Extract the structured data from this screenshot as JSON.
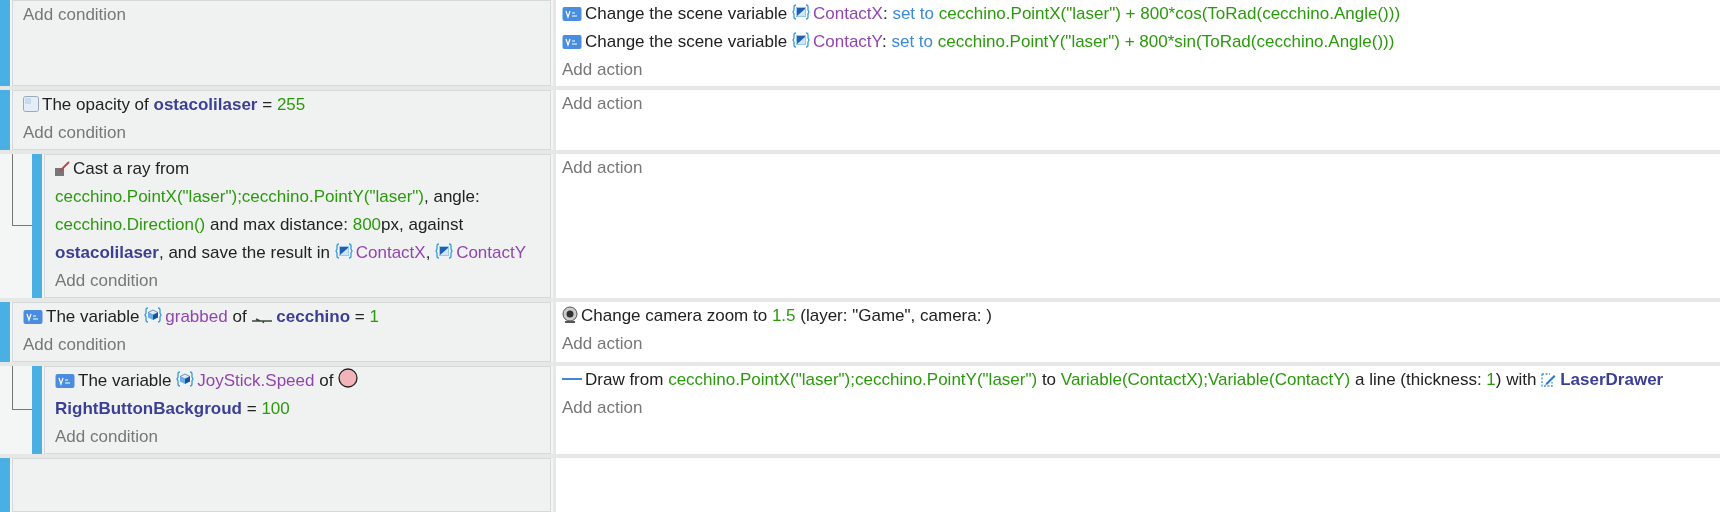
{
  "events": [
    {
      "add_condition": "Add condition",
      "actions": [
        {
          "kind": "variable",
          "parts": [
            {
              "kind": "text",
              "text": "Change the scene variable"
            },
            {
              "kind": "scene_variable",
              "text": "ContactX",
              "nospace": true
            },
            {
              "kind": "text",
              "text": ":"
            },
            {
              "kind": "keyword",
              "text": "set to"
            },
            {
              "kind": "value",
              "text": "cecchino.PointX(\"laser\") + 800*cos(ToRad(cecchino.Angle()))"
            }
          ]
        },
        {
          "kind": "variable",
          "parts": [
            {
              "kind": "text",
              "text": "Change the scene variable"
            },
            {
              "kind": "scene_variable",
              "text": "ContactY",
              "nospace": true
            },
            {
              "kind": "text",
              "text": ":"
            },
            {
              "kind": "keyword",
              "text": "set to"
            },
            {
              "kind": "value",
              "text": "cecchino.PointY(\"laser\") + 800*sin(ToRad(cecchino.Angle()))"
            }
          ]
        }
      ],
      "add_action": "Add action"
    },
    {
      "conditions": [
        {
          "kind": "opacity",
          "parts": [
            {
              "kind": "text",
              "text": "The opacity of"
            },
            {
              "kind": "object",
              "text": "ostacolilaser"
            },
            {
              "kind": "text",
              "text": "="
            },
            {
              "kind": "value",
              "text": "255"
            }
          ]
        }
      ],
      "add_condition": "Add condition",
      "add_action": "Add action",
      "children": [
        {
          "conditions": [
            {
              "kind": "raycast",
              "parts": [
                {
                  "kind": "text",
                  "text": "Cast a ray from"
                },
                {
                  "kind": "value",
                  "text": "cecchino.PointX(\"laser\");cecchino.PointY(\"laser\")",
                  "nospace": true
                },
                {
                  "kind": "text",
                  "text": ", angle:"
                },
                {
                  "kind": "value",
                  "text": "cecchino.Direction()"
                },
                {
                  "kind": "text",
                  "text": "and max distance:"
                },
                {
                  "kind": "value",
                  "text": "800",
                  "nospace": true
                },
                {
                  "kind": "text",
                  "text": "px, against"
                },
                {
                  "kind": "object",
                  "text": "ostacolilaser",
                  "nospace": true
                },
                {
                  "kind": "text",
                  "text": ", and save the result in"
                },
                {
                  "kind": "scene_variable",
                  "text": "ContactX",
                  "nospace": true
                },
                {
                  "kind": "text",
                  "text": ","
                },
                {
                  "kind": "scene_variable",
                  "text": "ContactY"
                }
              ]
            }
          ],
          "add_condition": "Add condition",
          "add_action": "Add action"
        }
      ]
    },
    {
      "conditions": [
        {
          "kind": "variable",
          "parts": [
            {
              "kind": "text",
              "text": "The variable"
            },
            {
              "kind": "object_variable",
              "text": "grabbed"
            },
            {
              "kind": "text",
              "text": "of"
            },
            {
              "kind": "sprite_object",
              "text": "cecchino"
            },
            {
              "kind": "text",
              "text": "="
            },
            {
              "kind": "value",
              "text": "1"
            }
          ]
        }
      ],
      "add_condition": "Add condition",
      "actions": [
        {
          "kind": "camera",
          "parts": [
            {
              "kind": "text",
              "text": "Change camera zoom to"
            },
            {
              "kind": "value",
              "text": "1.5"
            },
            {
              "kind": "text",
              "text": "(layer: \"Game\", camera: )"
            }
          ]
        }
      ],
      "add_action": "Add action",
      "children": [
        {
          "conditions": [
            {
              "kind": "variable",
              "parts": [
                {
                  "kind": "text",
                  "text": "The variable"
                },
                {
                  "kind": "object_variable",
                  "text": "JoyStick.Speed"
                },
                {
                  "kind": "text",
                  "text": "of"
                },
                {
                  "kind": "shape_object",
                  "text": "RightButtonBackgroud"
                },
                {
                  "kind": "text",
                  "text": "="
                },
                {
                  "kind": "value",
                  "text": "100"
                }
              ]
            }
          ],
          "add_condition": "Add condition",
          "actions": [
            {
              "kind": "line",
              "parts": [
                {
                  "kind": "text",
                  "text": "Draw from"
                },
                {
                  "kind": "value",
                  "text": "cecchino.PointX(\"laser\");cecchino.PointY(\"laser\")"
                },
                {
                  "kind": "text",
                  "text": "to"
                },
                {
                  "kind": "value",
                  "text": "Variable(ContactX);Variable(ContactY)"
                },
                {
                  "kind": "text",
                  "text": "a line (thickness:"
                },
                {
                  "kind": "value",
                  "text": "1",
                  "nospace": true
                },
                {
                  "kind": "text",
                  "text": ")"
                },
                {
                  "kind": "text",
                  "text": "with"
                },
                {
                  "kind": "painter_object",
                  "text": "LaserDrawer"
                }
              ]
            }
          ],
          "add_action": "Add action"
        }
      ]
    }
  ]
}
